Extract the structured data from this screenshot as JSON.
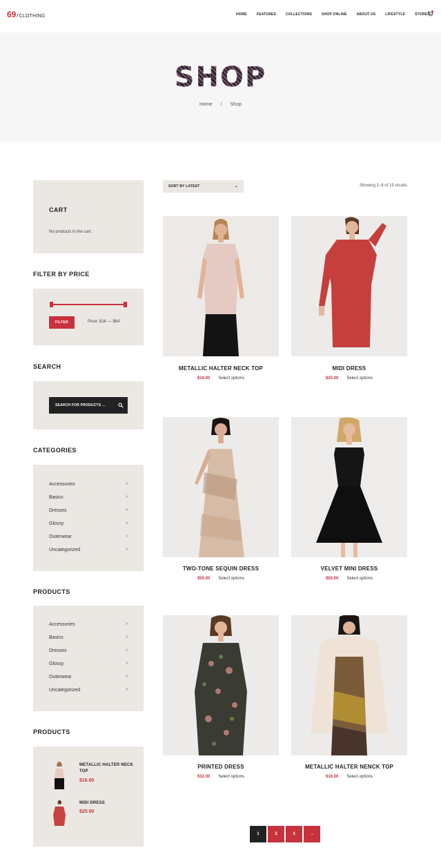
{
  "header": {
    "logo_number": "69",
    "logo_slash": "/",
    "logo_text": "CLOTHING",
    "nav": [
      "HOME",
      "FEATURES",
      "COLLECTIONS",
      "SHOP ONLINE",
      "ABOUT US",
      "LIFESTYLE",
      "STORES"
    ],
    "cart_count": "0"
  },
  "hero": {
    "title": "SHOP",
    "breadcrumb_home": "Home",
    "breadcrumb_sep": "/",
    "breadcrumb_current": "Shop"
  },
  "sidebar": {
    "cart_title": "CART",
    "cart_empty": "No products in the cart.",
    "filter_title": "FILTER BY PRICE",
    "filter_button": "FILTER",
    "price_label": "Price: $16 — $64",
    "search_title": "SEARCH",
    "search_placeholder": "SEARCH FOR PRODUCTS ...",
    "categories_title": "CATEGORIES",
    "categories": [
      "Accessories",
      "Basics",
      "Dresses",
      "Glossy",
      "Outerwear",
      "Uncategorized"
    ],
    "products_title": "PRODUCTS",
    "products_categories": [
      "Accessories",
      "Basics",
      "Dresses",
      "Glossy",
      "Outerwear",
      "Uncategorized"
    ],
    "products2_title": "PRODUCTS",
    "products_list": [
      {
        "name": "METALLIC HALTER NECK TOP",
        "price": "$16.00"
      },
      {
        "name": "MIDI DRESS",
        "price": "$25.00"
      }
    ]
  },
  "shop": {
    "sort_label": "SORT BY LATEST",
    "results_text": "Showing 1–8 of 19 results",
    "products": [
      {
        "title": "METALLIC HALTER NECK TOP",
        "price": "$16.00",
        "action": "Select options"
      },
      {
        "title": "MIDI DRESS",
        "price": "$25.00",
        "action": "Select options"
      },
      {
        "title": "TWO-TONE SEQUIN DRESS",
        "price": "$55.00",
        "action": "Select options"
      },
      {
        "title": "VELVET MINI DRESS",
        "price": "$50.00",
        "action": "Select options"
      },
      {
        "title": "PRINTED DRESS",
        "price": "$32.00",
        "action": "Select options"
      },
      {
        "title": "METALLIC HALTER NENCK TOP",
        "price": "$18.00",
        "action": "Select options"
      }
    ],
    "pagination": [
      "1",
      "2",
      "3",
      "→"
    ]
  },
  "colors": {
    "accent": "#c8323c",
    "panel": "#ebe8e4",
    "dark": "#222222",
    "hero_bg": "#f6f6f6"
  }
}
